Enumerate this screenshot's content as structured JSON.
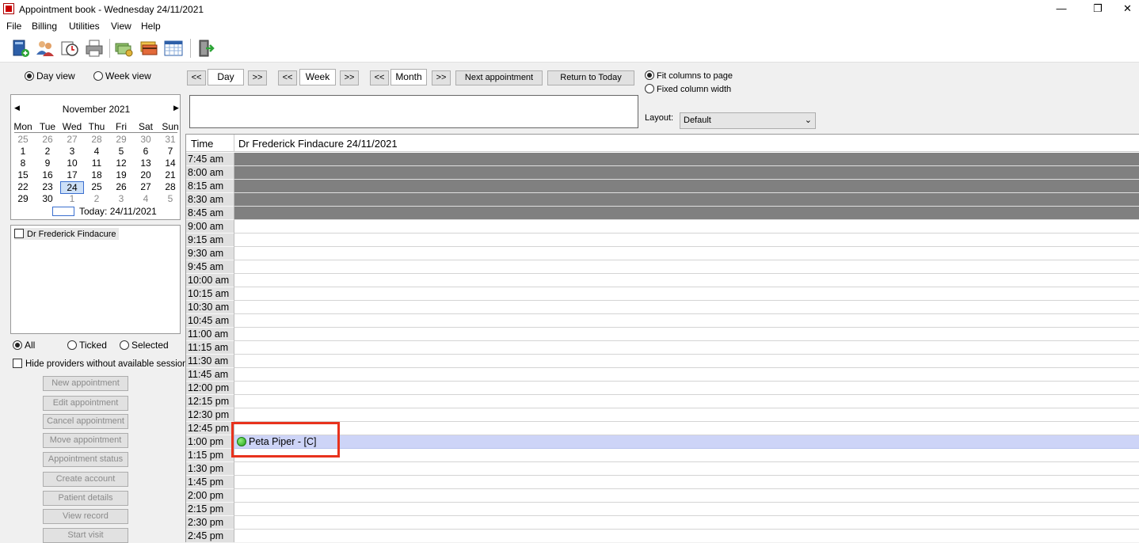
{
  "window": {
    "title": "Appointment book - Wednesday 24/11/2021",
    "min_glyph": "—",
    "max_glyph": "❐",
    "close_glyph": "✕"
  },
  "menu": [
    "File",
    "Billing",
    "Utilities",
    "View",
    "Help"
  ],
  "toolbar": {
    "icons": [
      "patient-book-icon",
      "patients-icon",
      "clock-icon",
      "printer-icon",
      "money-icon",
      "cards-icon",
      "calendar-icon",
      "exit-door-icon"
    ]
  },
  "view_mode": {
    "day": "Day view",
    "week": "Week view",
    "selected": "day"
  },
  "calendar": {
    "month": "November 2021",
    "prev": "◀",
    "next": "▶",
    "dow": [
      "Mon",
      "Tue",
      "Wed",
      "Thu",
      "Fri",
      "Sat",
      "Sun"
    ],
    "weeks": [
      [
        "25",
        "26",
        "27",
        "28",
        "29",
        "30",
        "31"
      ],
      [
        "1",
        "2",
        "3",
        "4",
        "5",
        "6",
        "7"
      ],
      [
        "8",
        "9",
        "10",
        "11",
        "12",
        "13",
        "14"
      ],
      [
        "15",
        "16",
        "17",
        "18",
        "19",
        "20",
        "21"
      ],
      [
        "22",
        "23",
        "24",
        "25",
        "26",
        "27",
        "28"
      ],
      [
        "29",
        "30",
        "1",
        "2",
        "3",
        "4",
        "5"
      ]
    ],
    "selected": "24",
    "today_label": "Today: 24/11/2021"
  },
  "providers": {
    "items": [
      "Dr Frederick Findacure"
    ]
  },
  "filter": {
    "all": "All",
    "ticked": "Ticked",
    "selected": "Selected",
    "hide_label": "Hide providers without available sessions"
  },
  "actions": [
    "New appointment",
    "Edit appointment",
    "Cancel appointment",
    "Move appointment",
    "Appointment status",
    "Create account",
    "Patient details",
    "View record",
    "Start visit"
  ],
  "nav": {
    "prev": "<<",
    "next": ">>",
    "day": "Day",
    "week": "Week",
    "month": "Month",
    "next_appointment": "Next appointment",
    "return_today": "Return to Today"
  },
  "column_options": {
    "fit": "Fit columns to page",
    "fixed": "Fixed column width"
  },
  "layout": {
    "label": "Layout:",
    "value": "Default",
    "chevron": "⌄"
  },
  "schedule": {
    "time_header": "Time",
    "provider_header": "Dr Frederick Findacure  24/11/2021",
    "slots": [
      "7:45 am",
      "8:00 am",
      "8:15 am",
      "8:30 am",
      "8:45 am",
      "9:00 am",
      "9:15 am",
      "9:30 am",
      "9:45 am",
      "10:00 am",
      "10:15 am",
      "10:30 am",
      "10:45 am",
      "11:00 am",
      "11:15 am",
      "11:30 am",
      "11:45 am",
      "12:00 pm",
      "12:15 pm",
      "12:30 pm",
      "12:45 pm",
      "1:00 pm",
      "1:15 pm",
      "1:30 pm",
      "1:45 pm",
      "2:00 pm",
      "2:15 pm",
      "2:30 pm",
      "2:45 pm"
    ],
    "blocked_slots": [
      "7:45 am",
      "8:00 am",
      "8:15 am",
      "8:30 am",
      "8:45 am"
    ],
    "appointment": {
      "time": "1:00 pm",
      "label": "Peta Piper - [C]"
    }
  }
}
